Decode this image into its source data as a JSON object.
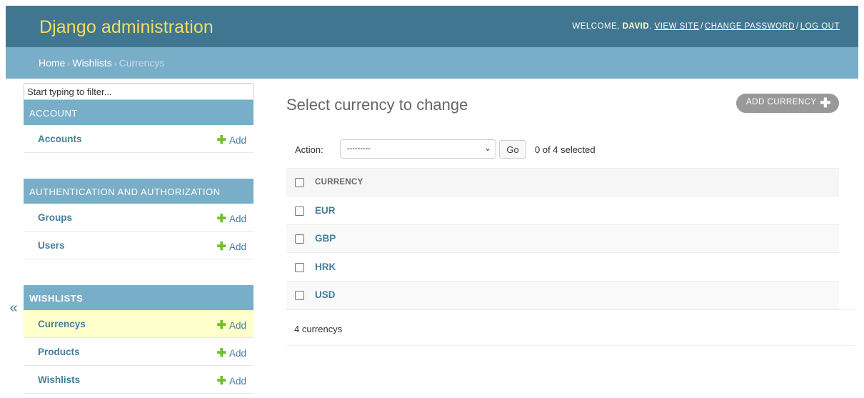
{
  "header": {
    "branding": "Django administration",
    "welcome": "WELCOME,",
    "username": "DAVID",
    "links": [
      "VIEW SITE",
      "CHANGE PASSWORD",
      "LOG OUT"
    ]
  },
  "breadcrumbs": [
    "Home",
    "Wishlists",
    "Currencys"
  ],
  "sidebar": {
    "filter_placeholder": "Start typing to filter...",
    "toggle": "«",
    "add_label": "Add",
    "modules": [
      {
        "caption": "ACCOUNT",
        "models": [
          {
            "name": "Accounts"
          }
        ]
      },
      {
        "caption": "AUTHENTICATION AND AUTHORIZATION",
        "models": [
          {
            "name": "Groups"
          },
          {
            "name": "Users"
          }
        ]
      },
      {
        "caption": "WISHLISTS",
        "models": [
          {
            "name": "Currencys"
          },
          {
            "name": "Products"
          },
          {
            "name": "Wishlists"
          }
        ]
      }
    ]
  },
  "main": {
    "title": "Select currency to change",
    "add_button": "ADD CURRENCY",
    "action_label": "Action:",
    "action_selected": "---------",
    "go_label": "Go",
    "selected_count": "0 of 4 selected",
    "column_header": "CURRENCY",
    "rows": [
      "EUR",
      "GBP",
      "HRK",
      "USD"
    ],
    "paginator": "4 currencys"
  },
  "colors": {
    "header_bg": "#417690",
    "branding": "#f5dd5d",
    "breadcrumbs_bg": "#79aec8",
    "link": "#447e9b",
    "current_row": "#ffffcc",
    "add_plus": "#70bf2b"
  }
}
